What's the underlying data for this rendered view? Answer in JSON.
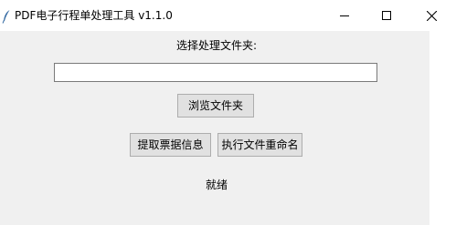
{
  "window": {
    "title": "PDF电子行程单处理工具 v1.1.0",
    "icons": [
      "feather-icon",
      "minimize-icon",
      "maximize-icon",
      "close-icon"
    ]
  },
  "main": {
    "folder_label": "选择处理文件夹:",
    "folder_path": "",
    "browse_label": "浏览文件夹",
    "extract_label": "提取票据信息",
    "rename_label": "执行文件重命名",
    "status": "就绪"
  },
  "colors": {
    "client_background": "#f0f0f0",
    "button_face": "#e1e1e1",
    "button_border": "#adadad"
  }
}
